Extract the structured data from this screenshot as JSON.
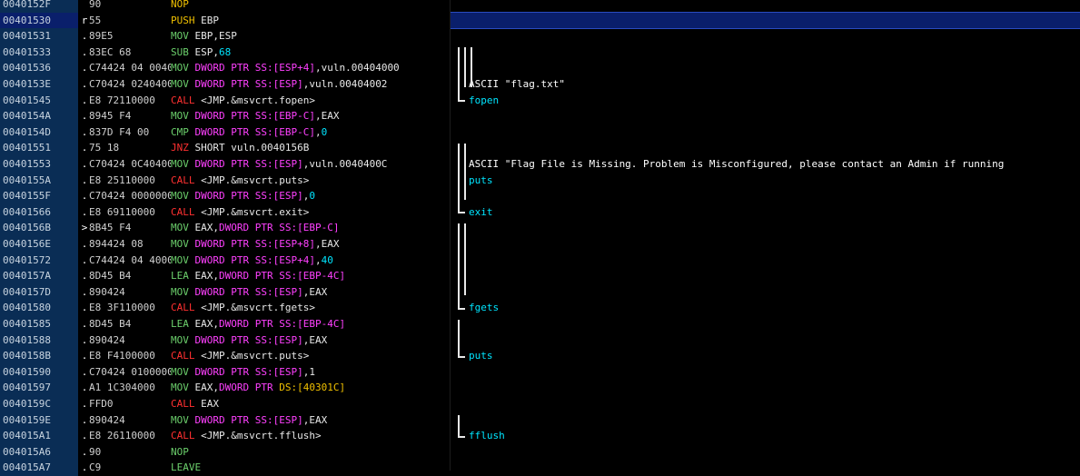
{
  "rows": [
    {
      "addr": "0040152F",
      "mark": "",
      "hex": "90",
      "dis": [
        {
          "t": "NOP",
          "c": "t-mnem"
        }
      ],
      "cmt": "",
      "sel": false
    },
    {
      "addr": "00401530",
      "mark": "r",
      "hex": "55",
      "dis": [
        {
          "t": "PUSH",
          "c": "t-mnem"
        },
        {
          "t": " EBP",
          "c": "t-plain"
        }
      ],
      "cmt": "",
      "sel": true
    },
    {
      "addr": "00401531",
      "mark": ".",
      "hex": "89E5",
      "dis": [
        {
          "t": "MOV",
          "c": "t-mov"
        },
        {
          "t": " EBP,ESP",
          "c": "t-plain"
        }
      ],
      "cmt": "",
      "sel": false
    },
    {
      "addr": "00401533",
      "mark": ".",
      "hex": "83EC 68",
      "dis": [
        {
          "t": "SUB",
          "c": "t-mov"
        },
        {
          "t": " ESP,",
          "c": "t-plain"
        },
        {
          "t": "68",
          "c": "t-imm"
        }
      ],
      "cmt": "",
      "sel": false
    },
    {
      "addr": "00401536",
      "mark": ".",
      "hex": "C74424 04 0040",
      "dis": [
        {
          "t": "MOV ",
          "c": "t-mov"
        },
        {
          "t": "DWORD PTR",
          "c": "t-ptr"
        },
        {
          "t": " SS:[ESP+4]",
          "c": "t-ptr"
        },
        {
          "t": ",vuln.00404000",
          "c": "t-plain"
        }
      ],
      "cmt": "",
      "sel": false
    },
    {
      "addr": "0040153E",
      "mark": ".",
      "hex": "C70424 0240400",
      "dis": [
        {
          "t": "MOV ",
          "c": "t-mov"
        },
        {
          "t": "DWORD PTR",
          "c": "t-ptr"
        },
        {
          "t": " SS:[ESP]",
          "c": "t-ptr"
        },
        {
          "t": ",vuln.00404002",
          "c": "t-plain"
        }
      ],
      "cmt": "ASCII \"flag.txt\"",
      "cmtApi": false,
      "sel": false
    },
    {
      "addr": "00401545",
      "mark": ".",
      "hex": "E8 72110000",
      "dis": [
        {
          "t": "CALL",
          "c": "t-call"
        },
        {
          "t": " <JMP.&msvcrt.fopen>",
          "c": "t-plain"
        }
      ],
      "cmt": "fopen",
      "cmtApi": true,
      "sel": false
    },
    {
      "addr": "0040154A",
      "mark": ".",
      "hex": "8945 F4",
      "dis": [
        {
          "t": "MOV ",
          "c": "t-mov"
        },
        {
          "t": "DWORD PTR",
          "c": "t-ptr"
        },
        {
          "t": " SS:[EBP-C]",
          "c": "t-ptr"
        },
        {
          "t": ",EAX",
          "c": "t-plain"
        }
      ],
      "cmt": "",
      "sel": false
    },
    {
      "addr": "0040154D",
      "mark": ".",
      "hex": "837D F4 00",
      "dis": [
        {
          "t": "CMP ",
          "c": "t-mov"
        },
        {
          "t": "DWORD PTR",
          "c": "t-ptr"
        },
        {
          "t": " SS:[EBP-C]",
          "c": "t-ptr"
        },
        {
          "t": ",",
          "c": "t-plain"
        },
        {
          "t": "0",
          "c": "t-imm"
        }
      ],
      "cmt": "",
      "sel": false
    },
    {
      "addr": "00401551",
      "mark": ".",
      "hex": "75 18",
      "dis": [
        {
          "t": "JNZ",
          "c": "t-jcc"
        },
        {
          "t": " SHORT vuln.0040156B",
          "c": "t-plain"
        }
      ],
      "cmt": "",
      "sel": false
    },
    {
      "addr": "00401553",
      "mark": ".",
      "hex": "C70424 0C40400",
      "dis": [
        {
          "t": "MOV ",
          "c": "t-mov"
        },
        {
          "t": "DWORD PTR",
          "c": "t-ptr"
        },
        {
          "t": " SS:[ESP]",
          "c": "t-ptr"
        },
        {
          "t": ",vuln.0040400C",
          "c": "t-plain"
        }
      ],
      "cmt": "ASCII \"Flag File is Missing. Problem is Misconfigured, please contact an Admin if running",
      "cmtApi": false,
      "sel": false
    },
    {
      "addr": "0040155A",
      "mark": ".",
      "hex": "E8 25110000",
      "dis": [
        {
          "t": "CALL",
          "c": "t-call"
        },
        {
          "t": " <JMP.&msvcrt.puts>",
          "c": "t-plain"
        }
      ],
      "cmt": "puts",
      "cmtApi": true,
      "sel": false
    },
    {
      "addr": "0040155F",
      "mark": ".",
      "hex": "C70424 0000000",
      "dis": [
        {
          "t": "MOV ",
          "c": "t-mov"
        },
        {
          "t": "DWORD PTR",
          "c": "t-ptr"
        },
        {
          "t": " SS:[ESP]",
          "c": "t-ptr"
        },
        {
          "t": ",",
          "c": "t-plain"
        },
        {
          "t": "0",
          "c": "t-imm"
        }
      ],
      "cmt": "",
      "sel": false
    },
    {
      "addr": "00401566",
      "mark": ".",
      "hex": "E8 69110000",
      "dis": [
        {
          "t": "CALL",
          "c": "t-call"
        },
        {
          "t": " <JMP.&msvcrt.exit>",
          "c": "t-plain"
        }
      ],
      "cmt": "exit",
      "cmtApi": true,
      "sel": false
    },
    {
      "addr": "0040156B",
      "mark": ">",
      "hex": "8B45 F4",
      "dis": [
        {
          "t": "MOV",
          "c": "t-mov"
        },
        {
          "t": " EAX,",
          "c": "t-plain"
        },
        {
          "t": "DWORD PTR SS:[EBP-C]",
          "c": "t-ptr"
        }
      ],
      "cmt": "",
      "sel": false
    },
    {
      "addr": "0040156E",
      "mark": ".",
      "hex": "894424 08",
      "dis": [
        {
          "t": "MOV ",
          "c": "t-mov"
        },
        {
          "t": "DWORD PTR",
          "c": "t-ptr"
        },
        {
          "t": " SS:[ESP+8]",
          "c": "t-ptr"
        },
        {
          "t": ",EAX",
          "c": "t-plain"
        }
      ],
      "cmt": "",
      "sel": false
    },
    {
      "addr": "00401572",
      "mark": ".",
      "hex": "C74424 04 4000",
      "dis": [
        {
          "t": "MOV ",
          "c": "t-mov"
        },
        {
          "t": "DWORD PTR",
          "c": "t-ptr"
        },
        {
          "t": " SS:[ESP+4]",
          "c": "t-ptr"
        },
        {
          "t": ",",
          "c": "t-plain"
        },
        {
          "t": "40",
          "c": "t-imm"
        }
      ],
      "cmt": "",
      "sel": false
    },
    {
      "addr": "0040157A",
      "mark": ".",
      "hex": "8D45 B4",
      "dis": [
        {
          "t": "LEA",
          "c": "t-mov"
        },
        {
          "t": " EAX,",
          "c": "t-plain"
        },
        {
          "t": "DWORD PTR SS:[EBP-4C]",
          "c": "t-ptr"
        }
      ],
      "cmt": "",
      "sel": false
    },
    {
      "addr": "0040157D",
      "mark": ".",
      "hex": "890424",
      "dis": [
        {
          "t": "MOV ",
          "c": "t-mov"
        },
        {
          "t": "DWORD PTR",
          "c": "t-ptr"
        },
        {
          "t": " SS:[ESP]",
          "c": "t-ptr"
        },
        {
          "t": ",EAX",
          "c": "t-plain"
        }
      ],
      "cmt": "",
      "sel": false
    },
    {
      "addr": "00401580",
      "mark": ".",
      "hex": "E8 3F110000",
      "dis": [
        {
          "t": "CALL",
          "c": "t-call"
        },
        {
          "t": " <JMP.&msvcrt.fgets>",
          "c": "t-plain"
        }
      ],
      "cmt": "fgets",
      "cmtApi": true,
      "sel": false
    },
    {
      "addr": "00401585",
      "mark": ".",
      "hex": "8D45 B4",
      "dis": [
        {
          "t": "LEA",
          "c": "t-mov"
        },
        {
          "t": " EAX,",
          "c": "t-plain"
        },
        {
          "t": "DWORD PTR SS:[EBP-4C]",
          "c": "t-ptr"
        }
      ],
      "cmt": "",
      "sel": false
    },
    {
      "addr": "00401588",
      "mark": ".",
      "hex": "890424",
      "dis": [
        {
          "t": "MOV ",
          "c": "t-mov"
        },
        {
          "t": "DWORD PTR",
          "c": "t-ptr"
        },
        {
          "t": " SS:[ESP]",
          "c": "t-ptr"
        },
        {
          "t": ",EAX",
          "c": "t-plain"
        }
      ],
      "cmt": "",
      "sel": false
    },
    {
      "addr": "0040158B",
      "mark": ".",
      "hex": "E8 F4100000",
      "dis": [
        {
          "t": "CALL",
          "c": "t-call"
        },
        {
          "t": " <JMP.&msvcrt.puts>",
          "c": "t-plain"
        }
      ],
      "cmt": "puts",
      "cmtApi": true,
      "sel": false
    },
    {
      "addr": "00401590",
      "mark": ".",
      "hex": "C70424 0100000",
      "dis": [
        {
          "t": "MOV ",
          "c": "t-mov"
        },
        {
          "t": "DWORD PTR",
          "c": "t-ptr"
        },
        {
          "t": " SS:[ESP]",
          "c": "t-ptr"
        },
        {
          "t": ",1",
          "c": "t-plain"
        }
      ],
      "cmt": "",
      "sel": false
    },
    {
      "addr": "00401597",
      "mark": ".",
      "hex": "A1 1C304000",
      "dis": [
        {
          "t": "MOV",
          "c": "t-mov"
        },
        {
          "t": " EAX,",
          "c": "t-plain"
        },
        {
          "t": "DWORD PTR",
          "c": "t-ptr"
        },
        {
          "t": " DS:[40301C]",
          "c": "t-mnem"
        }
      ],
      "cmt": "",
      "sel": false
    },
    {
      "addr": "0040159C",
      "mark": ".",
      "hex": "FFD0",
      "dis": [
        {
          "t": "CALL",
          "c": "t-call"
        },
        {
          "t": " EAX",
          "c": "t-plain"
        }
      ],
      "cmt": "",
      "sel": false
    },
    {
      "addr": "0040159E",
      "mark": ".",
      "hex": "890424",
      "dis": [
        {
          "t": "MOV ",
          "c": "t-mov"
        },
        {
          "t": "DWORD PTR",
          "c": "t-ptr"
        },
        {
          "t": " SS:[ESP]",
          "c": "t-ptr"
        },
        {
          "t": ",EAX",
          "c": "t-plain"
        }
      ],
      "cmt": "",
      "sel": false
    },
    {
      "addr": "004015A1",
      "mark": ".",
      "hex": "E8 26110000",
      "dis": [
        {
          "t": "CALL",
          "c": "t-call"
        },
        {
          "t": " <JMP.&msvcrt.fflush>",
          "c": "t-plain"
        }
      ],
      "cmt": "fflush",
      "cmtApi": true,
      "sel": false
    },
    {
      "addr": "004015A6",
      "mark": ".",
      "hex": "90",
      "dis": [
        {
          "t": "NOP",
          "c": "t-mov"
        }
      ],
      "cmt": "",
      "sel": false
    },
    {
      "addr": "004015A7",
      "mark": ".",
      "hex": "C9",
      "dis": [
        {
          "t": "LEAVE",
          "c": "t-mov"
        }
      ],
      "cmt": "",
      "sel": false
    }
  ]
}
